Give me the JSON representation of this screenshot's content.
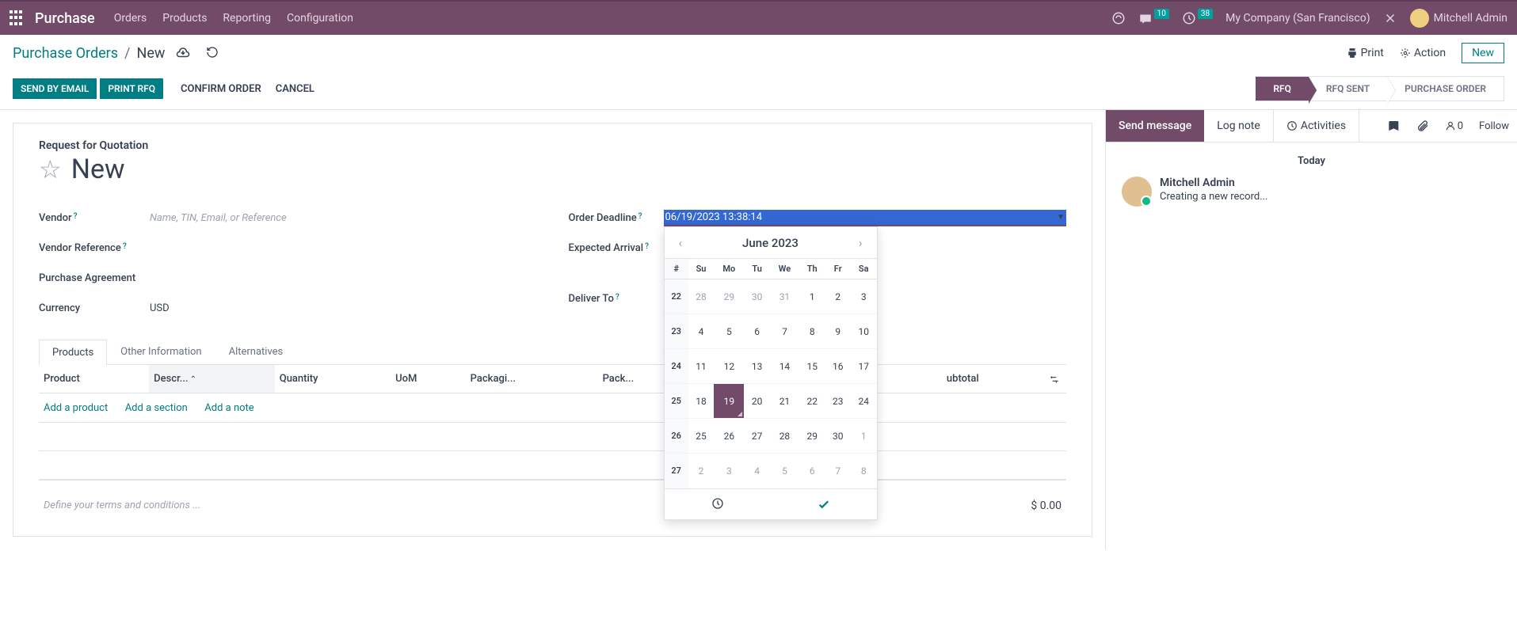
{
  "topnav": {
    "brand": "Purchase",
    "items": [
      "Orders",
      "Products",
      "Reporting",
      "Configuration"
    ],
    "msg_count": "10",
    "clock_count": "38",
    "company": "My Company (San Francisco)",
    "user": "Mitchell Admin"
  },
  "breadcrumb": {
    "root": "Purchase Orders",
    "current": "New",
    "print": "Print",
    "action": "Action",
    "new_btn": "New"
  },
  "statusbar": {
    "send_email": "SEND BY EMAIL",
    "print_rfq": "PRINT RFQ",
    "confirm": "CONFIRM ORDER",
    "cancel": "CANCEL",
    "stages": [
      "RFQ",
      "RFQ SENT",
      "PURCHASE ORDER"
    ]
  },
  "form": {
    "sub_title": "Request for Quotation",
    "name": "New",
    "vendor_label": "Vendor",
    "vendor_placeholder": "Name, TIN, Email, or Reference",
    "vendor_ref_label": "Vendor Reference",
    "purchase_agreement_label": "Purchase Agreement",
    "currency_label": "Currency",
    "currency_value": "USD",
    "order_deadline_label": "Order Deadline",
    "order_deadline_value": "06/19/2023 13:38:14",
    "expected_arrival_label": "Expected Arrival",
    "deliver_to_label": "Deliver To"
  },
  "tabs": [
    "Products",
    "Other Information",
    "Alternatives"
  ],
  "table": {
    "headers": {
      "product": "Product",
      "description": "Descr...",
      "quantity": "Quantity",
      "uom": "UoM",
      "packaging": "Packagi...",
      "pack": "Pack...",
      "subtotal": "ubtotal"
    },
    "add_product": "Add a product",
    "add_section": "Add a section",
    "add_note": "Add a note",
    "terms_placeholder": "Define your terms and conditions ...",
    "total": "$ 0.00"
  },
  "calendar": {
    "month": "June 2023",
    "day_headers": [
      "#",
      "Su",
      "Mo",
      "Tu",
      "We",
      "Th",
      "Fr",
      "Sa"
    ],
    "rows": [
      {
        "w": "22",
        "d": [
          "28",
          "29",
          "30",
          "31",
          "1",
          "2",
          "3"
        ],
        "other": [
          0,
          1,
          2,
          3
        ]
      },
      {
        "w": "23",
        "d": [
          "4",
          "5",
          "6",
          "7",
          "8",
          "9",
          "10"
        ],
        "other": []
      },
      {
        "w": "24",
        "d": [
          "11",
          "12",
          "13",
          "14",
          "15",
          "16",
          "17"
        ],
        "other": []
      },
      {
        "w": "25",
        "d": [
          "18",
          "19",
          "20",
          "21",
          "22",
          "23",
          "24"
        ],
        "other": [],
        "selected": 1
      },
      {
        "w": "26",
        "d": [
          "25",
          "26",
          "27",
          "28",
          "29",
          "30",
          "1"
        ],
        "other": [
          6
        ]
      },
      {
        "w": "27",
        "d": [
          "2",
          "3",
          "4",
          "5",
          "6",
          "7",
          "8"
        ],
        "other": [
          0,
          1,
          2,
          3,
          4,
          5,
          6
        ]
      }
    ]
  },
  "chatter": {
    "send": "Send message",
    "log": "Log note",
    "activities": "Activities",
    "follower_count": "0",
    "follow": "Follow",
    "date": "Today",
    "author": "Mitchell Admin",
    "message": "Creating a new record..."
  }
}
